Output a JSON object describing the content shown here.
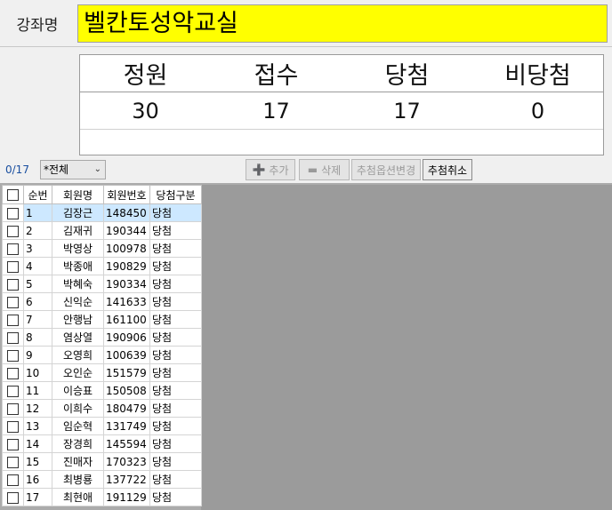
{
  "course": {
    "label": "강좌명",
    "name": "벨칸토성악교실"
  },
  "summary": {
    "headers": [
      "정원",
      "접수",
      "당첨",
      "비당첨"
    ],
    "values": [
      "30",
      "17",
      "17",
      "0"
    ]
  },
  "toolbar": {
    "count": "0/17",
    "filter_value": "*전체",
    "add_label": "추가",
    "delete_label": "삭제",
    "option_change_label": "추첨옵션변경",
    "cancel_label": "추첨취소"
  },
  "grid": {
    "columns": [
      "순번",
      "회원명",
      "회원번호",
      "당첨구분"
    ],
    "rows": [
      {
        "no": "1",
        "name": "김장근",
        "id": "148450",
        "status": "당첨"
      },
      {
        "no": "2",
        "name": "김재귀",
        "id": "190344",
        "status": "당첨"
      },
      {
        "no": "3",
        "name": "박영상",
        "id": "100978",
        "status": "당첨"
      },
      {
        "no": "4",
        "name": "박종애",
        "id": "190829",
        "status": "당첨"
      },
      {
        "no": "5",
        "name": "박혜숙",
        "id": "190334",
        "status": "당첨"
      },
      {
        "no": "6",
        "name": "신익순",
        "id": "141633",
        "status": "당첨"
      },
      {
        "no": "7",
        "name": "안행남",
        "id": "161100",
        "status": "당첨"
      },
      {
        "no": "8",
        "name": "염상열",
        "id": "190906",
        "status": "당첨"
      },
      {
        "no": "9",
        "name": "오영희",
        "id": "100639",
        "status": "당첨"
      },
      {
        "no": "10",
        "name": "오인순",
        "id": "151579",
        "status": "당첨"
      },
      {
        "no": "11",
        "name": "이승표",
        "id": "150508",
        "status": "당첨"
      },
      {
        "no": "12",
        "name": "이희수",
        "id": "180479",
        "status": "당첨"
      },
      {
        "no": "13",
        "name": "임순혁",
        "id": "131749",
        "status": "당첨"
      },
      {
        "no": "14",
        "name": "장경희",
        "id": "145594",
        "status": "당첨"
      },
      {
        "no": "15",
        "name": "진매자",
        "id": "170323",
        "status": "당첨"
      },
      {
        "no": "16",
        "name": "최병룡",
        "id": "137722",
        "status": "당첨"
      },
      {
        "no": "17",
        "name": "최현애",
        "id": "191129",
        "status": "당첨"
      }
    ]
  },
  "colors": {
    "course_field_bg": "#ffff00",
    "status_text": "#d01010",
    "selected_row": "#cde8ff"
  }
}
